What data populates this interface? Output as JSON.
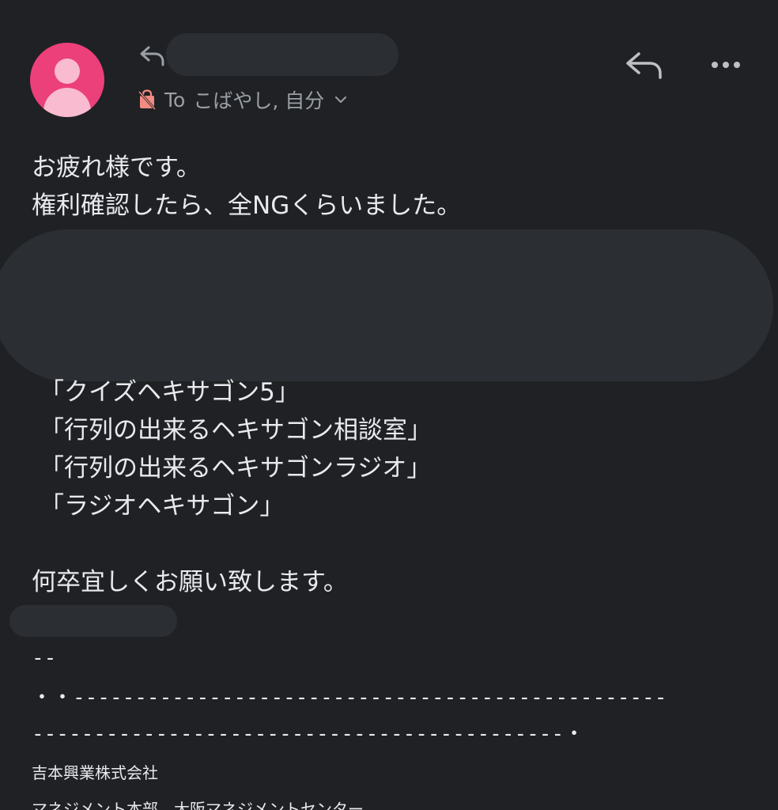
{
  "header": {
    "recipients_prefix": "To",
    "recipients": "こばやし, 自分",
    "avatar_color": "#ec407a",
    "icons": {
      "sender_reply": "reply-arrow-icon",
      "label": "shopping-bag-label-icon",
      "expand": "chevron-down-icon",
      "reply": "reply-icon",
      "more": "more-horizontal-icon"
    }
  },
  "body": {
    "greeting": "お疲れ様です。",
    "notice": "権利確認したら、全NGくらいました。",
    "titles": [
      "「クイズヘキサゴン5」",
      "「行列の出来るヘキサゴン相談室」",
      "「行列の出来るヘキサゴンラジオ」",
      "「ラジオヘキサゴン」"
    ],
    "closing": "何卒宜しくお願い致します。"
  },
  "signature": {
    "separator": "--",
    "rule_line_1": "・・------------------------------------------------",
    "rule_line_2": "-------------------------------------------・",
    "company": "吉本興業株式会社",
    "department": "マネジメント本部　大阪マネジメントセンター"
  }
}
